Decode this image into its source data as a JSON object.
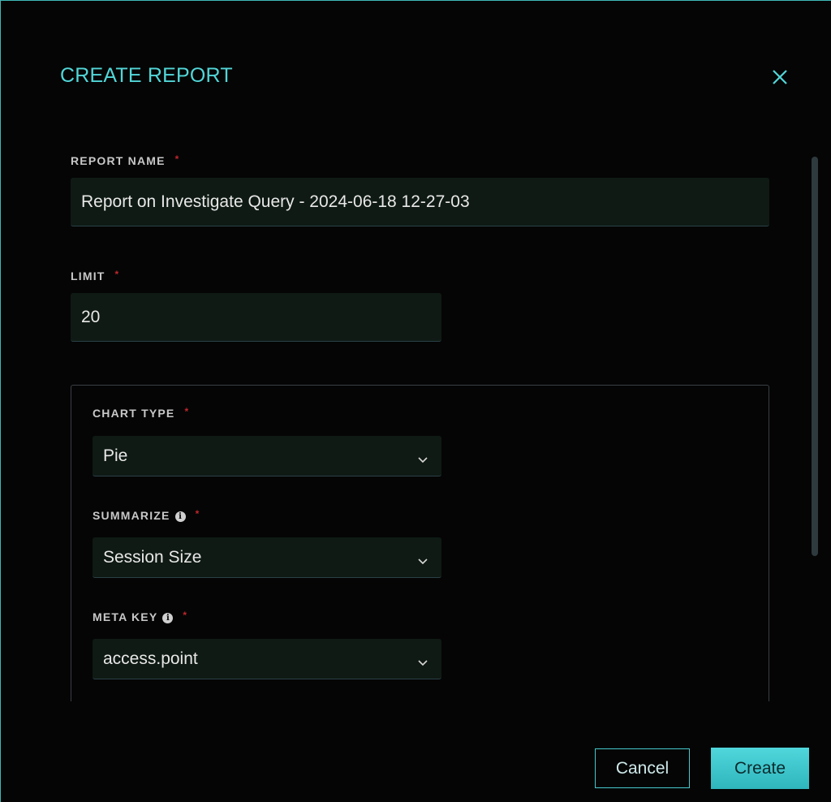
{
  "dialog": {
    "title": "CREATE REPORT",
    "close_icon": "close-icon"
  },
  "report_name": {
    "label": "REPORT NAME",
    "required_mark": "*",
    "value": "Report on Investigate Query - 2024-06-18 12-27-03"
  },
  "limit": {
    "label": "LIMIT",
    "required_mark": "*",
    "value": "20"
  },
  "chart_type": {
    "label": "CHART TYPE",
    "required_mark": "*",
    "value": "Pie"
  },
  "summarize": {
    "label": "SUMMARIZE",
    "info_icon": "i",
    "required_mark": "*",
    "value": "Session Size"
  },
  "meta_key": {
    "label": "META KEY",
    "info_icon": "i",
    "required_mark": "*",
    "value": "access.point"
  },
  "footer": {
    "cancel_label": "Cancel",
    "create_label": "Create"
  },
  "colors": {
    "accent": "#52d6d8",
    "required": "#c0262d",
    "field_bg": "#0f1a14",
    "primary_button": "#3ec6cc"
  }
}
